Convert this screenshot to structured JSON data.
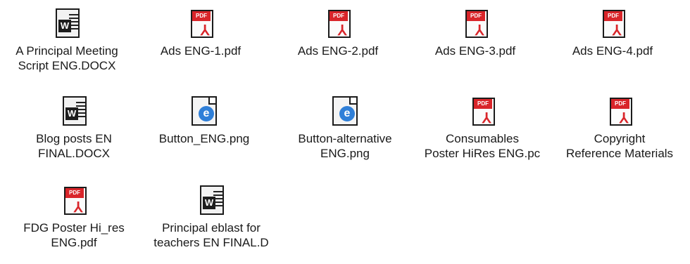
{
  "files": [
    {
      "type": "word",
      "label": [
        "A Principal Meeting",
        "Script ENG.DOCX"
      ]
    },
    {
      "type": "pdf",
      "label": [
        "Ads ENG-1.pdf"
      ]
    },
    {
      "type": "pdf",
      "label": [
        "Ads ENG-2.pdf"
      ]
    },
    {
      "type": "pdf",
      "label": [
        "Ads ENG-3.pdf"
      ]
    },
    {
      "type": "pdf",
      "label": [
        "Ads ENG-4.pdf"
      ]
    },
    {
      "type": "word",
      "label": [
        "Blog posts EN",
        "FINAL.DOCX"
      ]
    },
    {
      "type": "png",
      "label": [
        "Button_ENG.png"
      ]
    },
    {
      "type": "png",
      "label": [
        "Button-alternative",
        "ENG.png"
      ]
    },
    {
      "type": "pdf",
      "label": [
        "Consumables",
        "Poster HiRes ENG.pc"
      ]
    },
    {
      "type": "pdf",
      "label": [
        "Copyright",
        "Reference Materials"
      ]
    },
    {
      "type": "pdf",
      "label": [
        "FDG Poster Hi_res",
        "ENG.pdf"
      ]
    },
    {
      "type": "word",
      "label": [
        "Principal eblast for",
        "teachers EN FINAL.D"
      ]
    }
  ],
  "pdf_tab_text": "PDF",
  "word_badge_text": "W",
  "ie_badge_text": "e"
}
